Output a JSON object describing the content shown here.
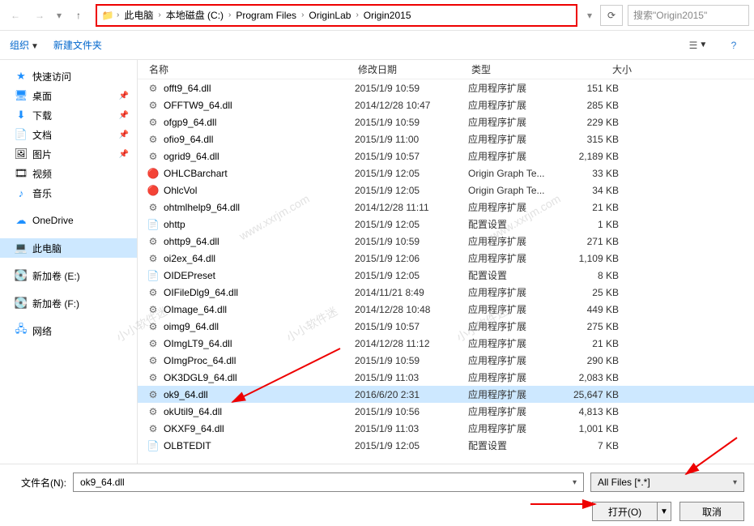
{
  "breadcrumb": [
    "此电脑",
    "本地磁盘 (C:)",
    "Program Files",
    "OriginLab",
    "Origin2015"
  ],
  "search_placeholder": "搜索\"Origin2015\"",
  "toolbar": {
    "organize": "组织",
    "new_folder": "新建文件夹"
  },
  "sidebar": {
    "quick": "快速访问",
    "desktop": "桌面",
    "downloads": "下载",
    "documents": "文档",
    "pictures": "图片",
    "videos": "视频",
    "music": "音乐",
    "onedrive": "OneDrive",
    "thispc": "此电脑",
    "volE": "新加卷 (E:)",
    "volF": "新加卷 (F:)",
    "network": "网络"
  },
  "columns": {
    "name": "名称",
    "date": "修改日期",
    "type": "类型",
    "size": "大小"
  },
  "files": [
    {
      "name": "offt9_64.dll",
      "date": "2015/1/9 10:59",
      "type": "应用程序扩展",
      "size": "151 KB",
      "icon": "dll"
    },
    {
      "name": "OFFTW9_64.dll",
      "date": "2014/12/28 10:47",
      "type": "应用程序扩展",
      "size": "285 KB",
      "icon": "dll"
    },
    {
      "name": "ofgp9_64.dll",
      "date": "2015/1/9 10:59",
      "type": "应用程序扩展",
      "size": "229 KB",
      "icon": "dll"
    },
    {
      "name": "ofio9_64.dll",
      "date": "2015/1/9 11:00",
      "type": "应用程序扩展",
      "size": "315 KB",
      "icon": "dll"
    },
    {
      "name": "ogrid9_64.dll",
      "date": "2015/1/9 10:57",
      "type": "应用程序扩展",
      "size": "2,189 KB",
      "icon": "dll"
    },
    {
      "name": "OHLCBarchart",
      "date": "2015/1/9 12:05",
      "type": "Origin Graph Te...",
      "size": "33 KB",
      "icon": "otp"
    },
    {
      "name": "OhlcVol",
      "date": "2015/1/9 12:05",
      "type": "Origin Graph Te...",
      "size": "34 KB",
      "icon": "otp"
    },
    {
      "name": "ohtmlhelp9_64.dll",
      "date": "2014/12/28 11:11",
      "type": "应用程序扩展",
      "size": "21 KB",
      "icon": "dll"
    },
    {
      "name": "ohttp",
      "date": "2015/1/9 12:05",
      "type": "配置设置",
      "size": "1 KB",
      "icon": "ini"
    },
    {
      "name": "ohttp9_64.dll",
      "date": "2015/1/9 10:59",
      "type": "应用程序扩展",
      "size": "271 KB",
      "icon": "dll"
    },
    {
      "name": "oi2ex_64.dll",
      "date": "2015/1/9 12:06",
      "type": "应用程序扩展",
      "size": "1,109 KB",
      "icon": "dll"
    },
    {
      "name": "OIDEPreset",
      "date": "2015/1/9 12:05",
      "type": "配置设置",
      "size": "8 KB",
      "icon": "ini"
    },
    {
      "name": "OIFileDlg9_64.dll",
      "date": "2014/11/21 8:49",
      "type": "应用程序扩展",
      "size": "25 KB",
      "icon": "dll"
    },
    {
      "name": "OImage_64.dll",
      "date": "2014/12/28 10:48",
      "type": "应用程序扩展",
      "size": "449 KB",
      "icon": "dll"
    },
    {
      "name": "oimg9_64.dll",
      "date": "2015/1/9 10:57",
      "type": "应用程序扩展",
      "size": "275 KB",
      "icon": "dll"
    },
    {
      "name": "OImgLT9_64.dll",
      "date": "2014/12/28 11:12",
      "type": "应用程序扩展",
      "size": "21 KB",
      "icon": "dll"
    },
    {
      "name": "OImgProc_64.dll",
      "date": "2015/1/9 10:59",
      "type": "应用程序扩展",
      "size": "290 KB",
      "icon": "dll"
    },
    {
      "name": "OK3DGL9_64.dll",
      "date": "2015/1/9 11:03",
      "type": "应用程序扩展",
      "size": "2,083 KB",
      "icon": "dll"
    },
    {
      "name": "ok9_64.dll",
      "date": "2016/6/20 2:31",
      "type": "应用程序扩展",
      "size": "25,647 KB",
      "icon": "dll",
      "selected": true
    },
    {
      "name": "okUtil9_64.dll",
      "date": "2015/1/9 10:56",
      "type": "应用程序扩展",
      "size": "4,813 KB",
      "icon": "dll"
    },
    {
      "name": "OKXF9_64.dll",
      "date": "2015/1/9 11:03",
      "type": "应用程序扩展",
      "size": "1,001 KB",
      "icon": "dll"
    },
    {
      "name": "OLBTEDIT",
      "date": "2015/1/9 12:05",
      "type": "配置设置",
      "size": "7 KB",
      "icon": "ini"
    }
  ],
  "bottom": {
    "filename_label": "文件名(N):",
    "filename_value": "ok9_64.dll",
    "filter": "All Files [*.*]",
    "open": "打开(O)",
    "cancel": "取消"
  },
  "watermark": "www.xxrjm.com",
  "watermark2": "小小软件迷"
}
